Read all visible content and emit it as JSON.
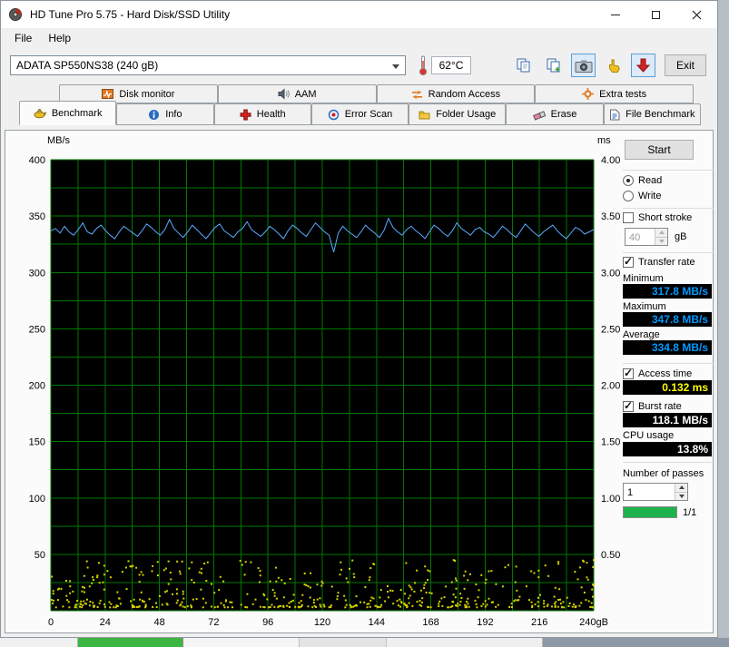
{
  "window": {
    "title": "HD Tune Pro 5.75 - Hard Disk/SSD Utility"
  },
  "menu": {
    "items": [
      "File",
      "Help"
    ]
  },
  "toolbar": {
    "drive": "ADATA SP550NS38 (240 gB)",
    "temperature": "62°C",
    "exit": "Exit"
  },
  "tabs": {
    "row1": [
      "Disk monitor",
      "AAM",
      "Random Access",
      "Extra tests"
    ],
    "row2": [
      "Benchmark",
      "Info",
      "Health",
      "Error Scan",
      "Folder Usage",
      "Erase",
      "File Benchmark"
    ],
    "active": "Benchmark"
  },
  "panel": {
    "start": "Start",
    "read": "Read",
    "write": "Write",
    "short_stroke": "Short stroke",
    "short_stroke_size": "40",
    "short_stroke_unit": "gB",
    "transfer_rate": "Transfer rate",
    "minimum_label": "Minimum",
    "minimum_value": "317.8 MB/s",
    "maximum_label": "Maximum",
    "maximum_value": "347.8 MB/s",
    "average_label": "Average",
    "average_value": "334.8 MB/s",
    "access_time": "Access time",
    "access_time_value": "0.132 ms",
    "burst_rate": "Burst rate",
    "burst_rate_value": "118.1 MB/s",
    "cpu_usage": "CPU usage",
    "cpu_usage_value": "13.8%",
    "passes_label": "Number of passes",
    "passes_value": "1",
    "progress_label": "1/1"
  },
  "colors": {
    "value_blue": "#0099ff",
    "value_yellow": "#ffff00",
    "value_white": "#ffffff",
    "progress_green": "#1db24c"
  },
  "chart_data": {
    "type": "line",
    "x": {
      "label": "gB",
      "min": 0,
      "max": 240,
      "grid_step": 12,
      "tick_values": [
        0,
        24,
        48,
        72,
        96,
        120,
        144,
        168,
        192,
        216,
        240
      ],
      "tick_labels": [
        "0",
        "24",
        "48",
        "72",
        "96",
        "120",
        "144",
        "168",
        "192",
        "216",
        "240gB"
      ]
    },
    "y_left": {
      "label": "MB/s",
      "min": 0,
      "max": 400,
      "grid_step": 25,
      "ticks": [
        400,
        350,
        300,
        250,
        200,
        150,
        100,
        50
      ]
    },
    "y_right": {
      "label": "ms",
      "min": 0,
      "max": 4,
      "ticks": [
        "4.00",
        "3.50",
        "3.00",
        "2.50",
        "2.00",
        "1.50",
        "1.00",
        "0.50"
      ]
    },
    "plot_bg": "#000000",
    "grid_color": "#007700",
    "legend": "off",
    "series": [
      {
        "name": "transfer-rate",
        "type": "line",
        "unit": "MB/s",
        "color": "#58acff",
        "min": 317.8,
        "max": 347.8,
        "avg": 334.8,
        "values": [
          337,
          339,
          335,
          341,
          336,
          333,
          338,
          344,
          336,
          334,
          339,
          342,
          337,
          333,
          330,
          336,
          341,
          338,
          335,
          332,
          337,
          343,
          340,
          336,
          333,
          338,
          347,
          339,
          335,
          331,
          336,
          342,
          338,
          334,
          330,
          335,
          340,
          343,
          337,
          334,
          331,
          336,
          339,
          345,
          338,
          335,
          332,
          336,
          341,
          338,
          334,
          330,
          337,
          342,
          339,
          335,
          332,
          338,
          344,
          340,
          336,
          333,
          318,
          335,
          341,
          337,
          334,
          331,
          336,
          342,
          338,
          335,
          331,
          337,
          348,
          340,
          336,
          333,
          338,
          341,
          337,
          334,
          330,
          336,
          342,
          339,
          335,
          332,
          337,
          344,
          339,
          336,
          333,
          338,
          340,
          336,
          334,
          331,
          336,
          341,
          338,
          334,
          331,
          337,
          343,
          339,
          335,
          332,
          336,
          339,
          342,
          337,
          333,
          330,
          335,
          340,
          338,
          334,
          336,
          338
        ]
      },
      {
        "name": "access-time",
        "type": "scatter",
        "unit": "ms",
        "color": "#d4d400",
        "typical": 0.132,
        "scatter": {
          "count": 520,
          "seed": 1234,
          "min": 0.03,
          "max": 0.45,
          "bias": 2.4
        }
      }
    ]
  }
}
